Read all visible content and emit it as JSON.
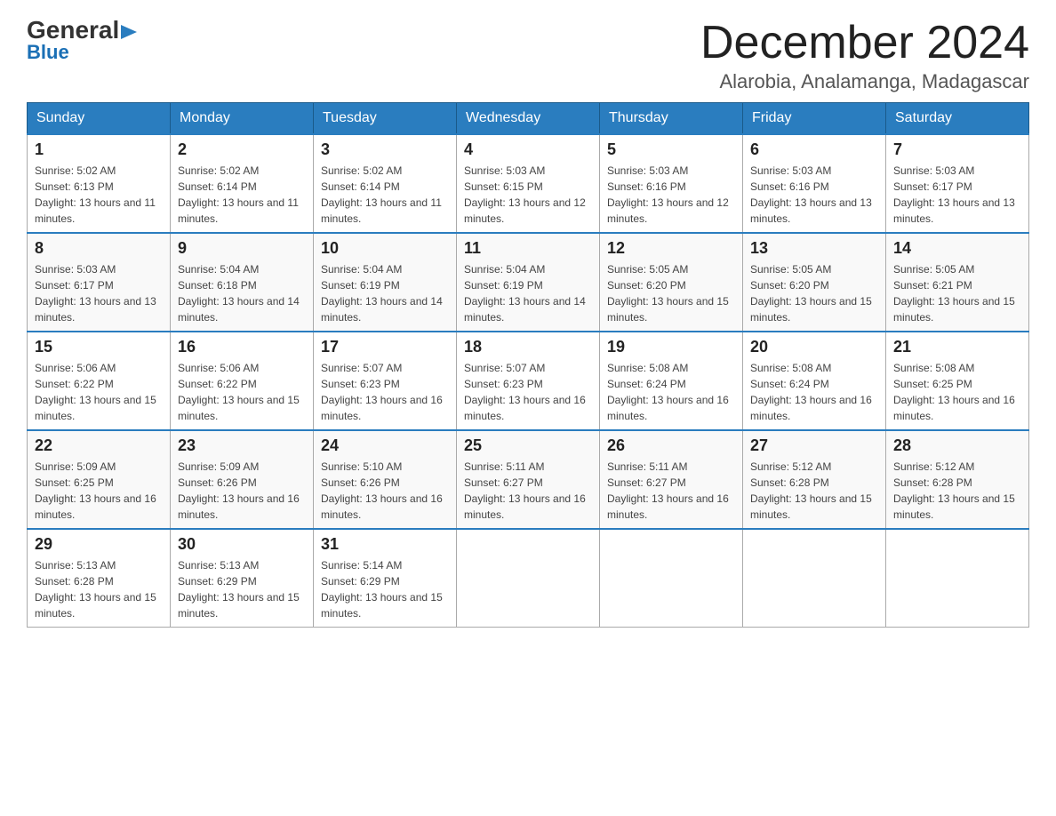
{
  "logo": {
    "line1": "General",
    "arrow": "▶",
    "line2": "Blue"
  },
  "title": "December 2024",
  "location": "Alarobia, Analamanga, Madagascar",
  "weekdays": [
    "Sunday",
    "Monday",
    "Tuesday",
    "Wednesday",
    "Thursday",
    "Friday",
    "Saturday"
  ],
  "weeks": [
    [
      {
        "day": "1",
        "sunrise": "5:02 AM",
        "sunset": "6:13 PM",
        "daylight": "13 hours and 11 minutes."
      },
      {
        "day": "2",
        "sunrise": "5:02 AM",
        "sunset": "6:14 PM",
        "daylight": "13 hours and 11 minutes."
      },
      {
        "day": "3",
        "sunrise": "5:02 AM",
        "sunset": "6:14 PM",
        "daylight": "13 hours and 11 minutes."
      },
      {
        "day": "4",
        "sunrise": "5:03 AM",
        "sunset": "6:15 PM",
        "daylight": "13 hours and 12 minutes."
      },
      {
        "day": "5",
        "sunrise": "5:03 AM",
        "sunset": "6:16 PM",
        "daylight": "13 hours and 12 minutes."
      },
      {
        "day": "6",
        "sunrise": "5:03 AM",
        "sunset": "6:16 PM",
        "daylight": "13 hours and 13 minutes."
      },
      {
        "day": "7",
        "sunrise": "5:03 AM",
        "sunset": "6:17 PM",
        "daylight": "13 hours and 13 minutes."
      }
    ],
    [
      {
        "day": "8",
        "sunrise": "5:03 AM",
        "sunset": "6:17 PM",
        "daylight": "13 hours and 13 minutes."
      },
      {
        "day": "9",
        "sunrise": "5:04 AM",
        "sunset": "6:18 PM",
        "daylight": "13 hours and 14 minutes."
      },
      {
        "day": "10",
        "sunrise": "5:04 AM",
        "sunset": "6:19 PM",
        "daylight": "13 hours and 14 minutes."
      },
      {
        "day": "11",
        "sunrise": "5:04 AM",
        "sunset": "6:19 PM",
        "daylight": "13 hours and 14 minutes."
      },
      {
        "day": "12",
        "sunrise": "5:05 AM",
        "sunset": "6:20 PM",
        "daylight": "13 hours and 15 minutes."
      },
      {
        "day": "13",
        "sunrise": "5:05 AM",
        "sunset": "6:20 PM",
        "daylight": "13 hours and 15 minutes."
      },
      {
        "day": "14",
        "sunrise": "5:05 AM",
        "sunset": "6:21 PM",
        "daylight": "13 hours and 15 minutes."
      }
    ],
    [
      {
        "day": "15",
        "sunrise": "5:06 AM",
        "sunset": "6:22 PM",
        "daylight": "13 hours and 15 minutes."
      },
      {
        "day": "16",
        "sunrise": "5:06 AM",
        "sunset": "6:22 PM",
        "daylight": "13 hours and 15 minutes."
      },
      {
        "day": "17",
        "sunrise": "5:07 AM",
        "sunset": "6:23 PM",
        "daylight": "13 hours and 16 minutes."
      },
      {
        "day": "18",
        "sunrise": "5:07 AM",
        "sunset": "6:23 PM",
        "daylight": "13 hours and 16 minutes."
      },
      {
        "day": "19",
        "sunrise": "5:08 AM",
        "sunset": "6:24 PM",
        "daylight": "13 hours and 16 minutes."
      },
      {
        "day": "20",
        "sunrise": "5:08 AM",
        "sunset": "6:24 PM",
        "daylight": "13 hours and 16 minutes."
      },
      {
        "day": "21",
        "sunrise": "5:08 AM",
        "sunset": "6:25 PM",
        "daylight": "13 hours and 16 minutes."
      }
    ],
    [
      {
        "day": "22",
        "sunrise": "5:09 AM",
        "sunset": "6:25 PM",
        "daylight": "13 hours and 16 minutes."
      },
      {
        "day": "23",
        "sunrise": "5:09 AM",
        "sunset": "6:26 PM",
        "daylight": "13 hours and 16 minutes."
      },
      {
        "day": "24",
        "sunrise": "5:10 AM",
        "sunset": "6:26 PM",
        "daylight": "13 hours and 16 minutes."
      },
      {
        "day": "25",
        "sunrise": "5:11 AM",
        "sunset": "6:27 PM",
        "daylight": "13 hours and 16 minutes."
      },
      {
        "day": "26",
        "sunrise": "5:11 AM",
        "sunset": "6:27 PM",
        "daylight": "13 hours and 16 minutes."
      },
      {
        "day": "27",
        "sunrise": "5:12 AM",
        "sunset": "6:28 PM",
        "daylight": "13 hours and 15 minutes."
      },
      {
        "day": "28",
        "sunrise": "5:12 AM",
        "sunset": "6:28 PM",
        "daylight": "13 hours and 15 minutes."
      }
    ],
    [
      {
        "day": "29",
        "sunrise": "5:13 AM",
        "sunset": "6:28 PM",
        "daylight": "13 hours and 15 minutes."
      },
      {
        "day": "30",
        "sunrise": "5:13 AM",
        "sunset": "6:29 PM",
        "daylight": "13 hours and 15 minutes."
      },
      {
        "day": "31",
        "sunrise": "5:14 AM",
        "sunset": "6:29 PM",
        "daylight": "13 hours and 15 minutes."
      },
      null,
      null,
      null,
      null
    ]
  ],
  "labels": {
    "sunrise": "Sunrise: ",
    "sunset": "Sunset: ",
    "daylight": "Daylight: "
  }
}
